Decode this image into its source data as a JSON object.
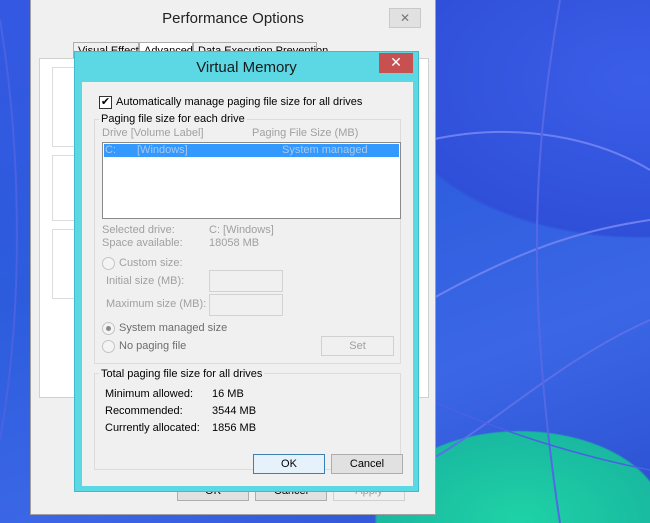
{
  "perf_dialog": {
    "title": "Performance Options",
    "close_glyph": "✕",
    "tabs": [
      "Visual Effects",
      "Advanced",
      "Data Execution Prevention"
    ],
    "buttons": {
      "ok": "OK",
      "cancel": "Cancel",
      "apply": "Apply"
    }
  },
  "vm_dialog": {
    "title": "Virtual Memory",
    "close_glyph": "✕",
    "auto_manage": {
      "label": "Automatically manage paging file size for all drives",
      "checked": true,
      "check_glyph": "✔"
    },
    "paging_group": {
      "title": "Paging file size for each drive",
      "columns": [
        "Drive  [Volume Label]",
        "Paging File Size (MB)"
      ],
      "rows": [
        {
          "drive": "C:",
          "label": "[Windows]",
          "size": "System managed",
          "selected": true
        }
      ],
      "selected_drive_label": "Selected drive:",
      "selected_drive_value": "C:  [Windows]",
      "space_available_label": "Space available:",
      "space_available_value": "18058 MB",
      "custom_size_label": "Custom size:",
      "initial_size_label": "Initial size (MB):",
      "initial_size_value": "",
      "maximum_size_label": "Maximum size (MB):",
      "maximum_size_value": "",
      "system_managed_label": "System managed size",
      "no_paging_label": "No paging file",
      "set_button": "Set",
      "selected_option": "system_managed"
    },
    "total_group": {
      "title": "Total paging file size for all drives",
      "minimum_label": "Minimum allowed:",
      "minimum_value": "16 MB",
      "recommended_label": "Recommended:",
      "recommended_value": "3544 MB",
      "allocated_label": "Currently allocated:",
      "allocated_value": "1856 MB"
    },
    "buttons": {
      "ok": "OK",
      "cancel": "Cancel"
    }
  },
  "colors": {
    "window_frame": "#5bd8e4",
    "close_button": "#c75050",
    "selection": "#3399ff",
    "dialog_bg": "#f0f0f0",
    "disabled_text": "#a0a0a0"
  }
}
